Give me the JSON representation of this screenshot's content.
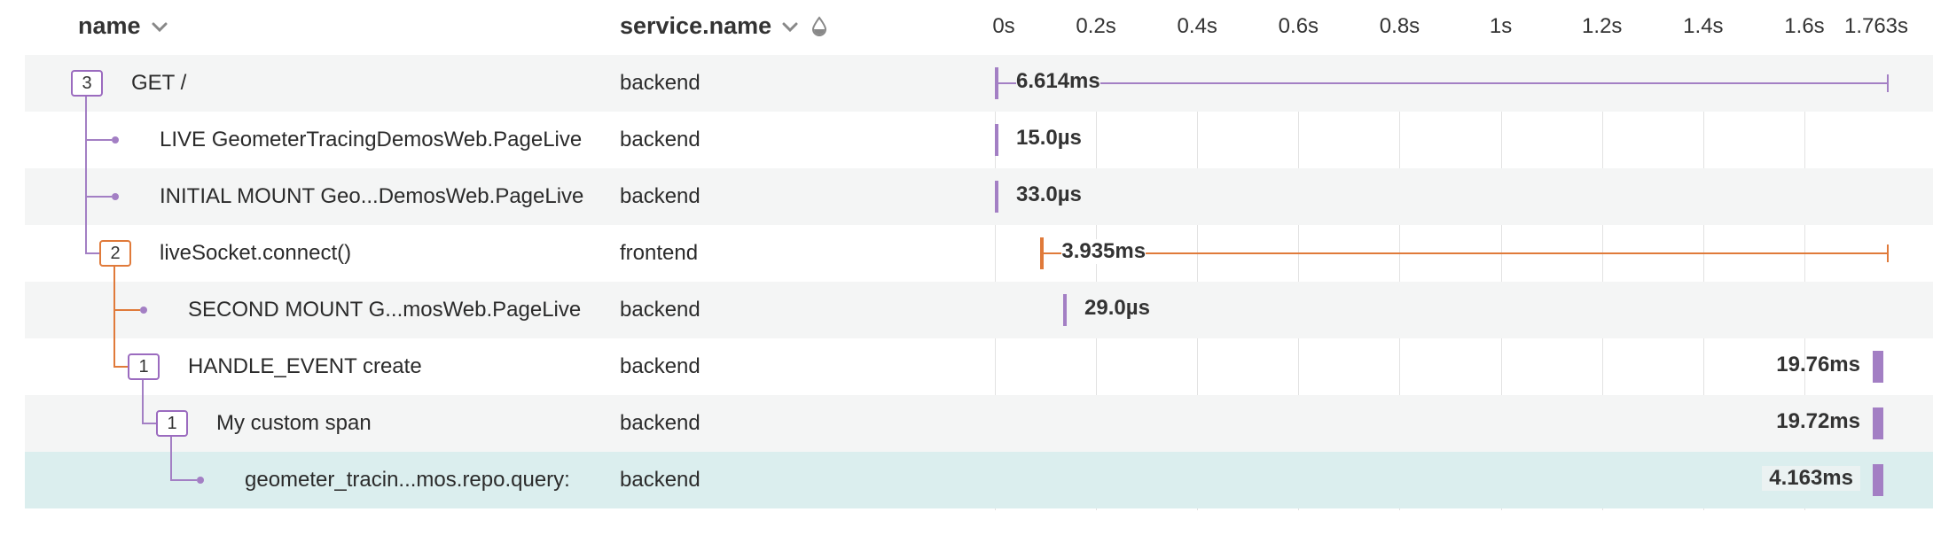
{
  "header": {
    "name_label": "name",
    "service_label": "service.name",
    "name_sort_icon": "chevron-down-icon",
    "service_sort_icon": "chevron-down-icon",
    "service_color_icon": "droplet-icon"
  },
  "timeline": {
    "total_duration_s": 1.763,
    "ticks": [
      "0s",
      "0.2s",
      "0.4s",
      "0.6s",
      "0.8s",
      "1s",
      "1.2s",
      "1.4s",
      "1.6s",
      "1.763s"
    ]
  },
  "colors": {
    "backend": "#a37fc4",
    "frontend": "#e07a3a",
    "selected_row": "#dbeeee"
  },
  "spans": [
    {
      "name": "GET /",
      "service": "backend",
      "count": "3",
      "duration": "6.614ms",
      "depth": 0,
      "start_s": 0.0,
      "whisker_end_s": 1.763
    },
    {
      "name": "LIVE GeometerTracingDemosWeb.PageLive",
      "service": "backend",
      "count": "",
      "duration": "15.0µs",
      "depth": 1,
      "start_s": 0.0
    },
    {
      "name": "INITIAL MOUNT Geo...DemosWeb.PageLive",
      "service": "backend",
      "count": "",
      "duration": "33.0µs",
      "depth": 1,
      "start_s": 0.0
    },
    {
      "name": "liveSocket.connect()",
      "service": "frontend",
      "count": "2",
      "duration": "3.935ms",
      "depth": 1,
      "start_s": 0.09,
      "whisker_end_s": 1.763
    },
    {
      "name": "SECOND MOUNT G...mosWeb.PageLive",
      "service": "backend",
      "count": "",
      "duration": "29.0µs",
      "depth": 2,
      "start_s": 0.135
    },
    {
      "name": "HANDLE_EVENT create",
      "service": "backend",
      "count": "1",
      "duration": "19.76ms",
      "depth": 2,
      "start_s": 1.74
    },
    {
      "name": "My custom span",
      "service": "backend",
      "count": "1",
      "duration": "19.72ms",
      "depth": 3,
      "start_s": 1.74
    },
    {
      "name": "geometer_tracin...mos.repo.query:",
      "service": "backend",
      "count": "",
      "duration": "4.163ms",
      "depth": 4,
      "start_s": 1.755,
      "selected": true
    }
  ]
}
